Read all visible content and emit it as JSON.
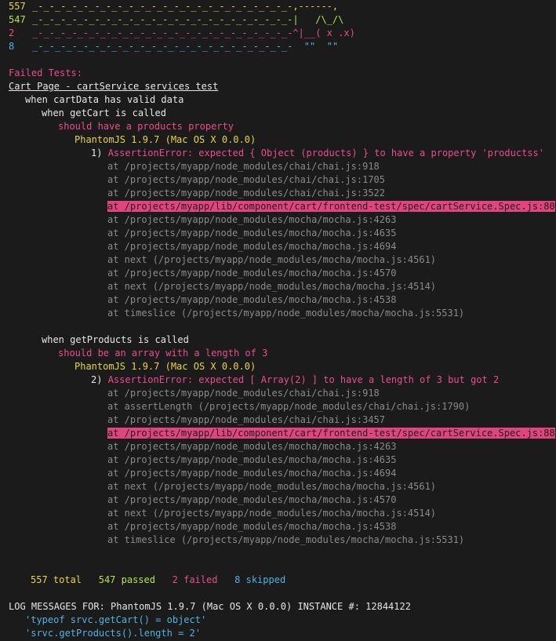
{
  "nyan": {
    "rows": [
      {
        "count": "557",
        "trail": "_-_-_-_-_-_-_-_-_-_-_-_-_-_-_-_-_-_-_-_-_-_-_-,------,",
        "color": "#e6d54a"
      },
      {
        "count": "547",
        "trail": "_-_-_-_-_-_-_-_-_-_-_-_-_-_-_-_-_-_-_-_-_-_-_-|   /\\_/\\",
        "color": "#b5e24a"
      },
      {
        "count": "2",
        "trail": "_-_-_-_-_-_-_-_-_-_-_-_-_-_-_-_-_-_-_-_-_-_-_-^|__( x .x)",
        "color": "#ec4c8d"
      },
      {
        "count": "8",
        "trail": "_-_-_-_-_-_-_-_-_-_-_-_-_-_-_-_-_-_-_-_-_-_-_-  \"\"  \"\"",
        "color": "#4fb3e3"
      }
    ]
  },
  "failed_header": "Failed Tests:",
  "suite_title": "Cart Page - cartService services test",
  "describe_cartdata": "when cartData has valid data",
  "describe_getcart": "when getCart is called",
  "test1": {
    "name": "should have a products property",
    "browser": "PhantomJS 1.9.7 (Mac OS X 0.0.0)",
    "num": "1)",
    "error": "AssertionError: expected { Object (products) } to have a property 'productss'",
    "stack": [
      "at /projects/myapp/node_modules/chai/chai.js:918",
      "at /projects/myapp/node_modules/chai/chai.js:1705",
      "at /projects/myapp/node_modules/chai/chai.js:3522",
      "at /projects/myapp/lib/component/cart/frontend-test/spec/cartService.Spec.js:80",
      "at /projects/myapp/node_modules/mocha/mocha.js:4263",
      "at /projects/myapp/node_modules/mocha/mocha.js:4635",
      "at /projects/myapp/node_modules/mocha/mocha.js:4694",
      "at next (/projects/myapp/node_modules/mocha/mocha.js:4561)",
      "at /projects/myapp/node_modules/mocha/mocha.js:4570",
      "at next (/projects/myapp/node_modules/mocha/mocha.js:4514)",
      "at /projects/myapp/node_modules/mocha/mocha.js:4538",
      "at timeslice (/projects/myapp/node_modules/mocha/mocha.js:5531)"
    ],
    "highlight_index": 3
  },
  "describe_getproducts": "when getProducts is called",
  "test2": {
    "name": "should be an array with a length of 3",
    "browser": "PhantomJS 1.9.7 (Mac OS X 0.0.0)",
    "num": "2)",
    "error": "AssertionError: expected [ Array(2) ] to have a length of 3 but got 2",
    "stack": [
      "at /projects/myapp/node_modules/chai/chai.js:918",
      "at assertLength (/projects/myapp/node_modules/chai/chai.js:1790)",
      "at /projects/myapp/node_modules/chai/chai.js:3457",
      "at /projects/myapp/lib/component/cart/frontend-test/spec/cartService.Spec.js:88",
      "at /projects/myapp/node_modules/mocha/mocha.js:4263",
      "at /projects/myapp/node_modules/mocha/mocha.js:4635",
      "at /projects/myapp/node_modules/mocha/mocha.js:4694",
      "at next (/projects/myapp/node_modules/mocha/mocha.js:4561)",
      "at /projects/myapp/node_modules/mocha/mocha.js:4570",
      "at next (/projects/myapp/node_modules/mocha/mocha.js:4514)",
      "at /projects/myapp/node_modules/mocha/mocha.js:4538",
      "at timeslice (/projects/myapp/node_modules/mocha/mocha.js:5531)"
    ],
    "highlight_index": 3
  },
  "summary": {
    "total": "557 total",
    "passed": "547 passed",
    "failed": "2 failed",
    "skipped": "8 skipped"
  },
  "log": {
    "header": "LOG MESSAGES FOR: PhantomJS 1.9.7 (Mac OS X 0.0.0) INSTANCE #: 12844122",
    "messages": [
      "'typeof srvc.getCart() = object'",
      "'srvc.getProducts().length = 2'"
    ]
  },
  "colors": {
    "background": "#1b1b1b",
    "pink": "#ec4c8d",
    "highlight": "#e2457e",
    "yellow": "#e6d54a",
    "green": "#b5e24a",
    "blue": "#4fb3e3",
    "gray": "#8a8a8a"
  }
}
